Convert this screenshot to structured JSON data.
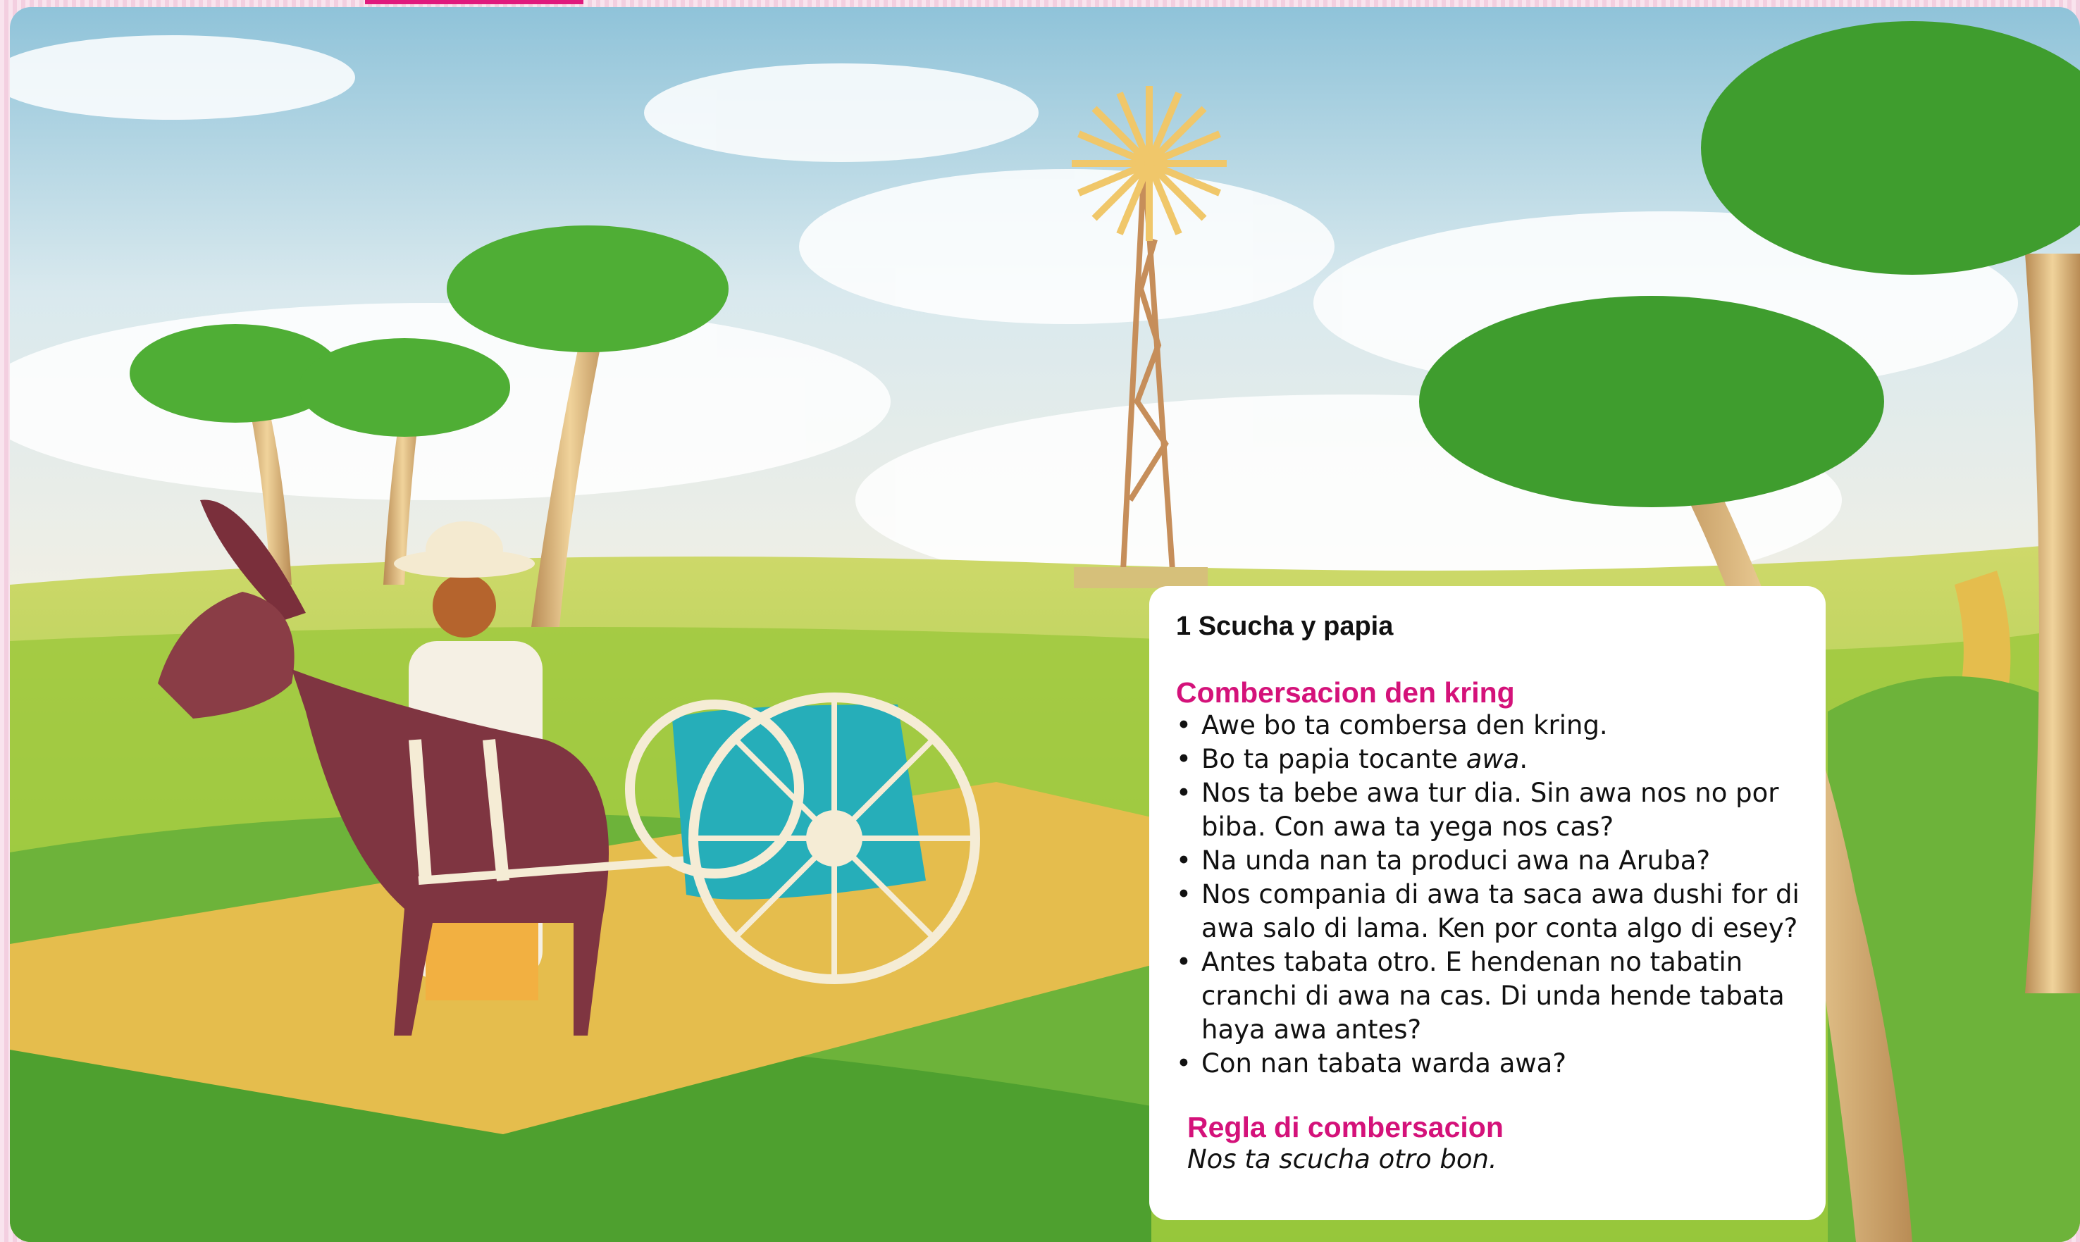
{
  "card": {
    "title": "1 Scucha y papia",
    "section1_heading": "Combersacion den kring",
    "items": [
      {
        "text": "Awe bo ta combersa den kring."
      },
      {
        "before": "Bo ta papia tocante ",
        "italic": "awa",
        "after": "."
      },
      {
        "text": "Nos ta bebe awa tur dia. Sin awa nos no por biba. Con awa ta yega nos cas?"
      },
      {
        "text": "Na unda nan ta produci awa na Aruba?"
      },
      {
        "text": "Nos compania di awa ta saca awa dushi for di awa salo di lama. Ken por conta algo di esey?"
      },
      {
        "text": "Antes tabata otro. E hendenan no tabatin cranchi di awa na cas. Di unda hende tabata haya awa antes?"
      },
      {
        "text": "Con nan tabata warda awa?"
      }
    ],
    "section2_heading": "Regla di combersacion",
    "rule": "Nos ta scucha otro bon."
  },
  "colors": {
    "accent": "#d4127a",
    "frame": "#f7d6e6",
    "tab": "#e0197d"
  }
}
